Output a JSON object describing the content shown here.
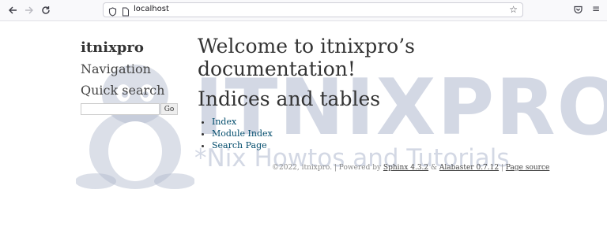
{
  "browser": {
    "url": "localhost",
    "icons": [
      "back-icon",
      "forward-icon",
      "reload-icon",
      "shield-icon",
      "page-icon",
      "bookmark-star-icon",
      "pocket-icon",
      "menu-icon"
    ]
  },
  "watermark": {
    "brand": "ITNIXPRO",
    "tagline": "*Nix Howtos and Tutorials"
  },
  "sidebar": {
    "logo_title": "itnixpro",
    "navigation_heading": "Navigation",
    "search_heading": "Quick search",
    "search_value": "",
    "search_button": "Go"
  },
  "main": {
    "title": "Welcome to itnixpro’s documentation!",
    "indices_heading": "Indices and tables",
    "links": [
      {
        "label": "Index"
      },
      {
        "label": "Module Index"
      },
      {
        "label": "Search Page"
      }
    ]
  },
  "footer": {
    "copyright": "©2022, itnixpro. | Powered by ",
    "sphinx": "Sphinx 4.3.2",
    "amp": " & ",
    "alabaster": "Alabaster 0.7.12",
    "sep": " | ",
    "page_source": "Page source"
  },
  "colors": {
    "link": "#004b6b",
    "text": "#333333",
    "watermark": "#afb8cd"
  }
}
